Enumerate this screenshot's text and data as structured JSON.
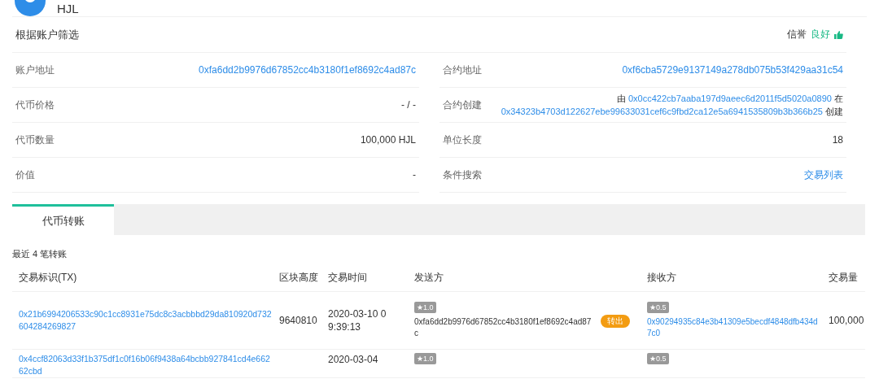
{
  "header": {
    "title": "HJL"
  },
  "filter": {
    "title": "根据账户筛选",
    "reputation_label": "信誉",
    "reputation_value": "良好"
  },
  "info": {
    "left": [
      {
        "label": "账户地址",
        "kind": "link",
        "value": "0xfa6dd2b9976d67852cc4b3180f1ef8692c4ad87c"
      },
      {
        "label": "代币价格",
        "kind": "text",
        "value": "- / -"
      },
      {
        "label": "代币数量",
        "kind": "text",
        "value": "100,000 HJL"
      },
      {
        "label": "价值",
        "kind": "text",
        "value": "-"
      }
    ],
    "right": [
      {
        "label": "合约地址",
        "kind": "link",
        "value": "0xf6cba5729e9137149a278db075b53f429aa31c54"
      },
      {
        "label": "合约创建",
        "kind": "parts",
        "parts": [
          {
            "kind": "text",
            "text": "由"
          },
          {
            "kind": "link",
            "text": "0x0cc422cb7aaba197d9aeec6d2011f5d5020a0890"
          },
          {
            "kind": "text",
            "text": "在"
          },
          {
            "kind": "link",
            "text": "0x34323b4703d122627ebe99633031cef6c9fbd2ca12e5a6941535809b3b366b25"
          },
          {
            "kind": "text",
            "text": "创建"
          }
        ]
      },
      {
        "label": "单位长度",
        "kind": "text",
        "value": "18"
      },
      {
        "label": "条件搜索",
        "kind": "link",
        "value": "交易列表"
      }
    ]
  },
  "tabs": [
    {
      "label": "代币转账",
      "selected": true
    }
  ],
  "transfers": {
    "summary": "最近 4 笔转账",
    "columns": [
      "交易标识(TX)",
      "区块高度",
      "交易时间",
      "发送方",
      "接收方",
      "交易量"
    ],
    "rows": [
      {
        "tx": "0x21b6994206533c90c1cc8931e75dc8c3acbbbd29da810920d732604284269827",
        "block": "9640810",
        "time": "2020-03-10 09:39:13",
        "sender_rating": "★1.0",
        "sender": "0xfa6dd2b9976d67852cc4b3180f1ef8692c4ad87c",
        "direction": "转出",
        "receiver_rating": "★0.5",
        "receiver": "0x90294935c84e3b41309e5becdf4848dfb434d7c0",
        "amount": "100,000"
      },
      {
        "tx": "0x4ccf82063d33f1b375df1c0f16b06f9438a64bcbb927841cd4e66262cbd",
        "time": "2020-03-04",
        "sender_rating": "★1.0",
        "receiver_rating": "★0.5"
      }
    ]
  }
}
